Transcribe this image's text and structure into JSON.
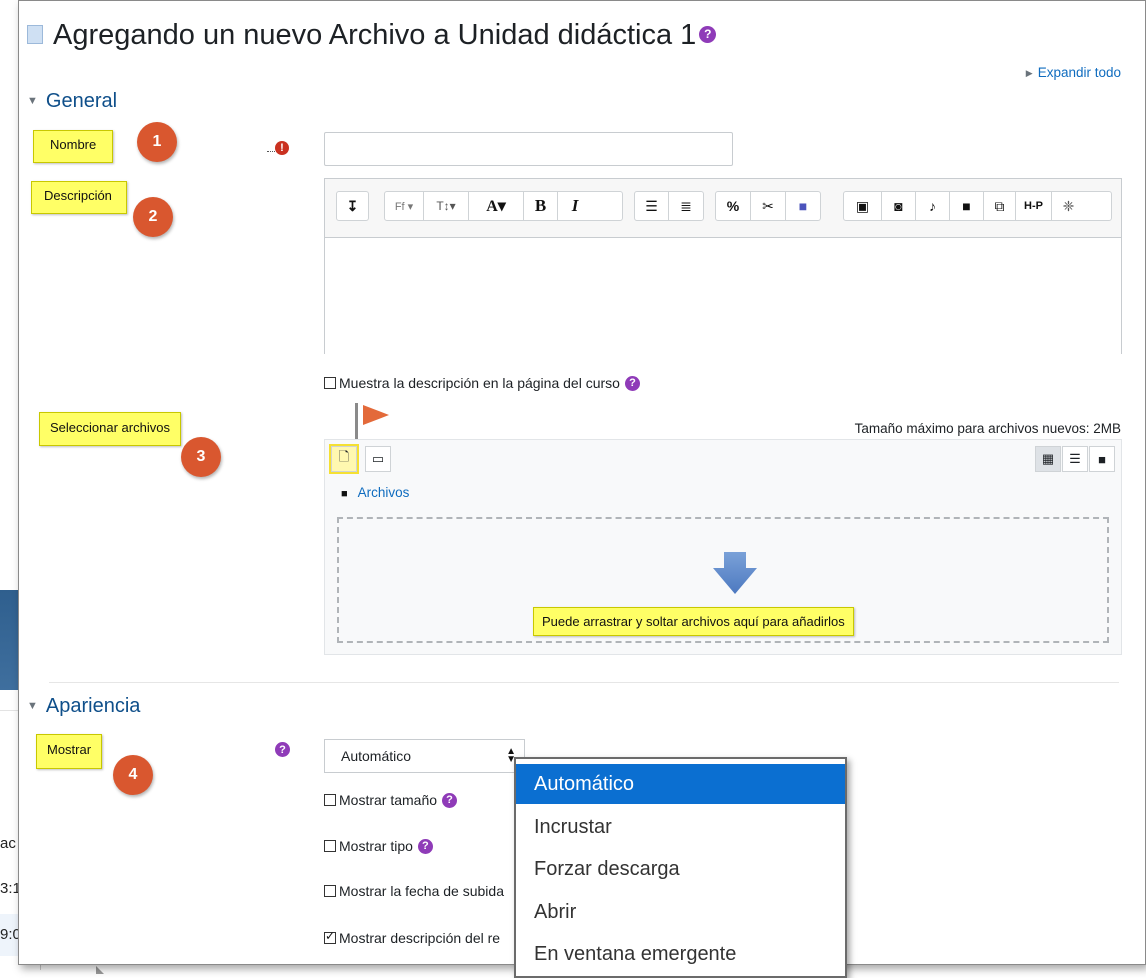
{
  "background_window": {
    "rows": [
      "ac",
      "3:1",
      "9:0"
    ]
  },
  "page": {
    "title": "Agregando un nuevo Archivo a Unidad didáctica 1",
    "expand_all": "Expandir todo"
  },
  "general": {
    "heading": "General",
    "name_label": "Nombre",
    "name_value": "",
    "description_label": "Descripción",
    "show_description": "Muestra la descripción en la página del curso",
    "select_files_label": "Seleccionar archivos",
    "max_size": "Tamaño máximo para archivos nuevos: 2MB",
    "files_crumb": "Archivos",
    "drop_message": "Puede arrastrar y soltar archivos aquí para añadirlos"
  },
  "editor_toolbar": {
    "groups": [
      [
        "collapse-icon"
      ],
      [
        "font-family",
        "font-size",
        "text-color",
        "bold",
        "italic"
      ],
      [
        "unordered-list",
        "ordered-list"
      ],
      [
        "link",
        "unlink",
        "teams-meeting"
      ],
      [
        "image",
        "media",
        "record-audio",
        "record-video",
        "manage-files",
        "h5p",
        "equation"
      ]
    ],
    "labels": {
      "collapse": "↧",
      "font_family": "Ff ▾",
      "font_size": "T↕▾",
      "text_color": "A▾",
      "bold": "B",
      "italic": "I",
      "h5p": "H-P"
    }
  },
  "appearance": {
    "heading": "Apariencia",
    "display_label": "Mostrar",
    "display_value": "Automático",
    "show_size": "Mostrar tamaño",
    "show_type": "Mostrar tipo",
    "show_upload_date": "Mostrar la fecha de subida",
    "show_description": "Mostrar descripción del re",
    "display_options": [
      "Automático",
      "Incrustar",
      "Forzar descarga",
      "Abrir",
      "En ventana emergente"
    ],
    "selected_option": "Automático"
  },
  "annotations": {
    "numbers": [
      "1",
      "2",
      "3",
      "4"
    ]
  },
  "colors": {
    "accent": "#0f6cbf",
    "help_icon": "#8f3bb8",
    "required_icon": "#ca3120",
    "callout_yellow": "#ffff66",
    "step_badge": "#d9572f",
    "selected_option": "#0b6fd1"
  }
}
